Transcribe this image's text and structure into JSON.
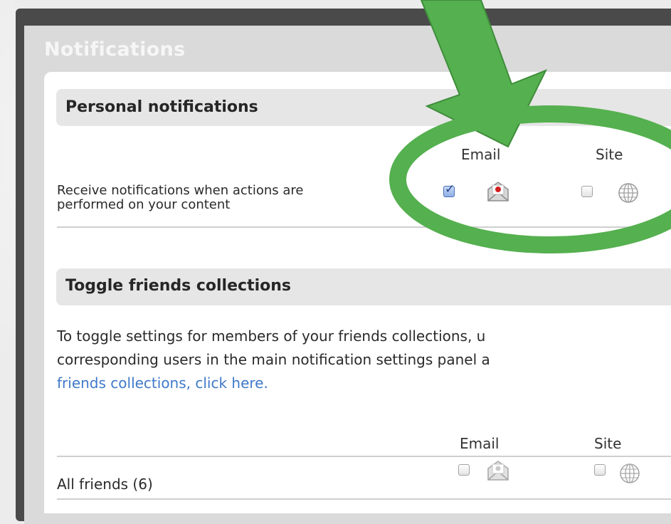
{
  "panel": {
    "title": "Notifications"
  },
  "personal": {
    "title": "Personal notifications",
    "columns": {
      "email": "Email",
      "site": "Site"
    },
    "rows": [
      {
        "label_line1": "Receive notifications when actions are",
        "label_line2": "performed on your content",
        "email_checked": true,
        "site_checked": false
      }
    ]
  },
  "friends": {
    "title": "Toggle friends collections",
    "description_line1": "To toggle settings for members of your friends collections, u",
    "description_line2": "corresponding users in the main notification settings panel a",
    "link": "friends collections, click here.",
    "columns": {
      "email": "Email",
      "site": "Site"
    },
    "rows": [
      {
        "label": "All friends (6)",
        "email_checked": false,
        "site_checked": false
      }
    ]
  },
  "icons": {
    "email": "envelope-icon",
    "site": "globe-icon",
    "annotation_arrow": "arrow-icon",
    "annotation_circle": "highlight-ellipse"
  },
  "colors": {
    "annotation_green": "#55b04f",
    "link_blue": "#3f79c9",
    "panel_dark": "#4a4a4a"
  }
}
